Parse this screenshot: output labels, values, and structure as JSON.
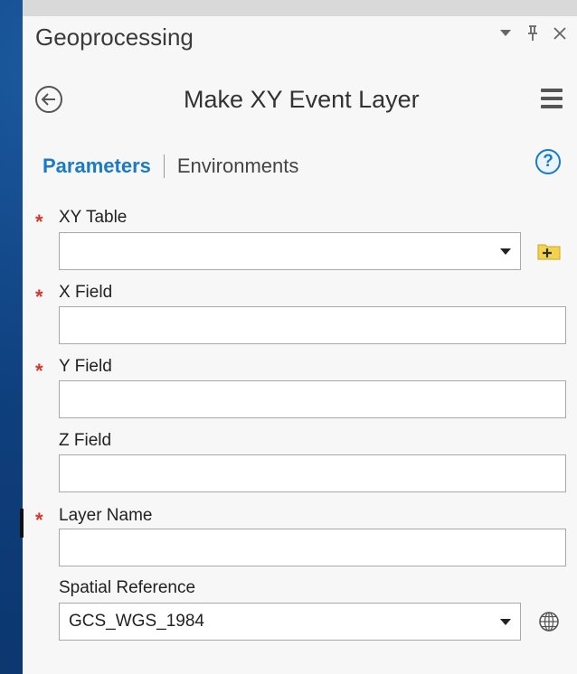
{
  "pane": {
    "title": "Geoprocessing",
    "controls": {
      "auto_hide_icon": "pin-icon",
      "close_icon": "close-icon"
    }
  },
  "tool": {
    "title": "Make XY Event Layer",
    "back_icon": "back-arrow-icon",
    "menu_icon": "hamburger-menu-icon"
  },
  "tabs": [
    {
      "label": "Parameters",
      "active": true
    },
    {
      "label": "Environments",
      "active": false
    }
  ],
  "help_label": "?",
  "parameters": [
    {
      "label": "XY Table",
      "required": true,
      "type": "dropdown",
      "value": "",
      "side_button": "add-data-folder-icon"
    },
    {
      "label": "X Field",
      "required": true,
      "type": "text",
      "value": ""
    },
    {
      "label": "Y Field",
      "required": true,
      "type": "text",
      "value": ""
    },
    {
      "label": "Z Field",
      "required": false,
      "type": "text",
      "value": ""
    },
    {
      "label": "Layer Name",
      "required": true,
      "type": "text",
      "value": ""
    },
    {
      "label": "Spatial Reference",
      "required": false,
      "type": "dropdown",
      "value": "GCS_WGS_1984",
      "side_button": "globe-icon"
    }
  ],
  "required_marker": "*",
  "colors": {
    "accent": "#1a7ac6",
    "required": "#d3382c",
    "panel": "#f7f7f7",
    "background": "#0e3f7d"
  }
}
